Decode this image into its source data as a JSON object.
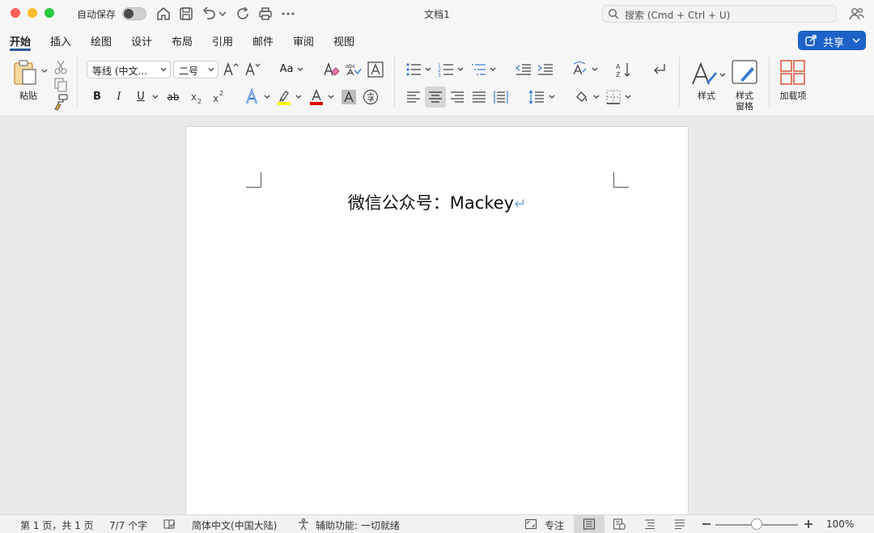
{
  "titlebar": {
    "autosave_label": "自动保存",
    "doc_title": "文档1",
    "search_placeholder": "搜索 (Cmd + Ctrl + U)"
  },
  "tabs": [
    {
      "label": "开始",
      "active": true
    },
    {
      "label": "插入"
    },
    {
      "label": "绘图"
    },
    {
      "label": "设计"
    },
    {
      "label": "布局"
    },
    {
      "label": "引用"
    },
    {
      "label": "邮件"
    },
    {
      "label": "审阅"
    },
    {
      "label": "视图"
    }
  ],
  "share_label": "共享",
  "ribbon": {
    "paste_label": "粘贴",
    "font_name": "等线 (中文...",
    "font_size": "二号",
    "change_case_label": "Aa",
    "bold": "B",
    "italic": "I",
    "underline": "U",
    "strike": "ab",
    "styles_label": "样式",
    "styles_pane_label_1": "样式",
    "styles_pane_label_2": "窗格",
    "addins_label": "加载项"
  },
  "document": {
    "text": "微信公众号：Mackey"
  },
  "status": {
    "page": "第 1 页，共 1 页",
    "words": "7/7 个字",
    "language": "简体中文(中国大陆)",
    "accessibility": "辅助功能: 一切就绪",
    "focus": "专注",
    "zoom": "100%"
  },
  "colors": {
    "accent": "#1c62c8",
    "highlight": "#ffff00",
    "font_color": "#e00000"
  }
}
